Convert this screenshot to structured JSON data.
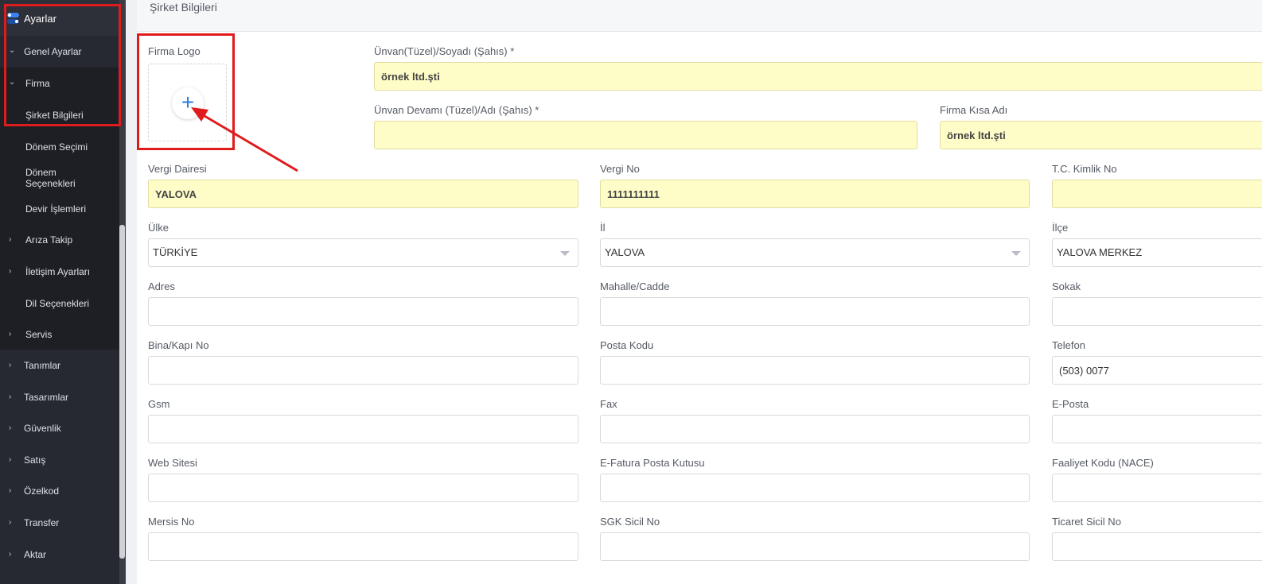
{
  "sidebar": {
    "title": "Ayarlar",
    "items": [
      {
        "label": "Genel Ayarlar",
        "chev": "⌄"
      },
      {
        "label": "Firma",
        "chev": "⌄"
      },
      {
        "label": "Şirket Bilgileri"
      },
      {
        "label": "Dönem Seçimi"
      },
      {
        "label": "Dönem Seçenekleri"
      },
      {
        "label": "Devir İşlemleri"
      },
      {
        "label": "Arıza Takip",
        "chev": "›"
      },
      {
        "label": "İletişim Ayarları",
        "chev": "›"
      },
      {
        "label": "Dil Seçenekleri"
      },
      {
        "label": "Servis",
        "chev": "›"
      },
      {
        "label": "Tanımlar",
        "chev": "›"
      },
      {
        "label": "Tasarımlar",
        "chev": "›"
      },
      {
        "label": "Güvenlik",
        "chev": "›"
      },
      {
        "label": "Satış",
        "chev": "›"
      },
      {
        "label": "Özelkod",
        "chev": "›"
      },
      {
        "label": "Transfer",
        "chev": "›"
      },
      {
        "label": "Aktar",
        "chev": "›"
      }
    ]
  },
  "page": {
    "title": "Şirket Bilgileri",
    "logo_label": "Firma Logo",
    "plus_glyph": "+"
  },
  "form": {
    "unvan": {
      "label": "Ünvan(Tüzel)/Soyadı (Şahıs) *",
      "value": "örnek ltd.şti"
    },
    "unvan_devami": {
      "label": "Ünvan Devamı (Tüzel)/Adı (Şahıs) *",
      "value": ""
    },
    "kisa_adi": {
      "label": "Firma Kısa Adı",
      "value": "örnek ltd.şti"
    },
    "vergi_dairesi": {
      "label": "Vergi Dairesi",
      "value": "YALOVA"
    },
    "vergi_no": {
      "label": "Vergi No",
      "value": "1111111111"
    },
    "tc_kimlik": {
      "label": "T.C. Kimlik No",
      "value": ""
    },
    "ulke": {
      "label": "Ülke",
      "value": "TÜRKİYE"
    },
    "il": {
      "label": "İl",
      "value": "YALOVA"
    },
    "ilce": {
      "label": "İlçe",
      "value": "YALOVA MERKEZ"
    },
    "adres": {
      "label": "Adres",
      "value": ""
    },
    "mahalle": {
      "label": "Mahalle/Cadde",
      "value": ""
    },
    "sokak": {
      "label": "Sokak",
      "value": ""
    },
    "bina": {
      "label": "Bina/Kapı No",
      "value": ""
    },
    "posta_kodu": {
      "label": "Posta Kodu",
      "value": ""
    },
    "telefon": {
      "label": "Telefon",
      "value": "(503) 0077"
    },
    "gsm": {
      "label": "Gsm",
      "value": ""
    },
    "fax": {
      "label": "Fax",
      "value": ""
    },
    "eposta": {
      "label": "E-Posta",
      "value": ""
    },
    "web": {
      "label": "Web Sitesi",
      "value": ""
    },
    "efatura": {
      "label": "E-Fatura Posta Kutusu",
      "value": ""
    },
    "faaliyet": {
      "label": "Faaliyet Kodu (NACE)",
      "value": ""
    },
    "mersis": {
      "label": "Mersis No",
      "value": ""
    },
    "sgk": {
      "label": "SGK Sicil No",
      "value": ""
    },
    "ticaret": {
      "label": "Ticaret Sicil No",
      "value": ""
    }
  },
  "colors": {
    "sidebar_bg": "#262932",
    "required_bg": "#fffdc7",
    "annotation_red": "#e01b1b",
    "accent_blue": "#2a7de1"
  }
}
